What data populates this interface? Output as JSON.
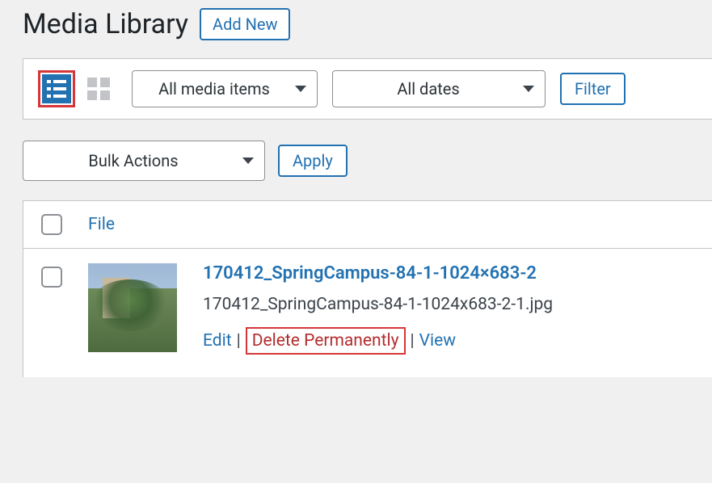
{
  "page": {
    "title": "Media Library",
    "add_new": "Add New"
  },
  "filters": {
    "media_type": "All media items",
    "dates": "All dates",
    "filter_btn": "Filter"
  },
  "bulk": {
    "label": "Bulk Actions",
    "apply": "Apply"
  },
  "columns": {
    "file": "File"
  },
  "item": {
    "title": "170412_SpringCampus-84-1-1024×683-2",
    "filename": "170412_SpringCampus-84-1-1024x683-2-1.jpg",
    "actions": {
      "edit": "Edit",
      "delete": "Delete Permanently",
      "view": "View"
    }
  }
}
